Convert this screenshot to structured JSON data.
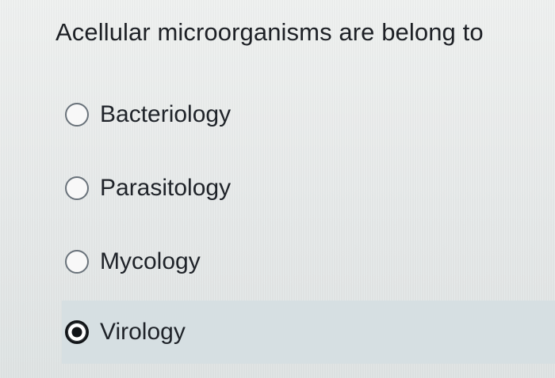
{
  "question": {
    "text": "Acellular microorganisms are belong to"
  },
  "options": [
    {
      "label": "Bacteriology",
      "selected": false
    },
    {
      "label": "Parasitology",
      "selected": false
    },
    {
      "label": "Mycology",
      "selected": false
    },
    {
      "label": "Virology",
      "selected": true
    }
  ]
}
